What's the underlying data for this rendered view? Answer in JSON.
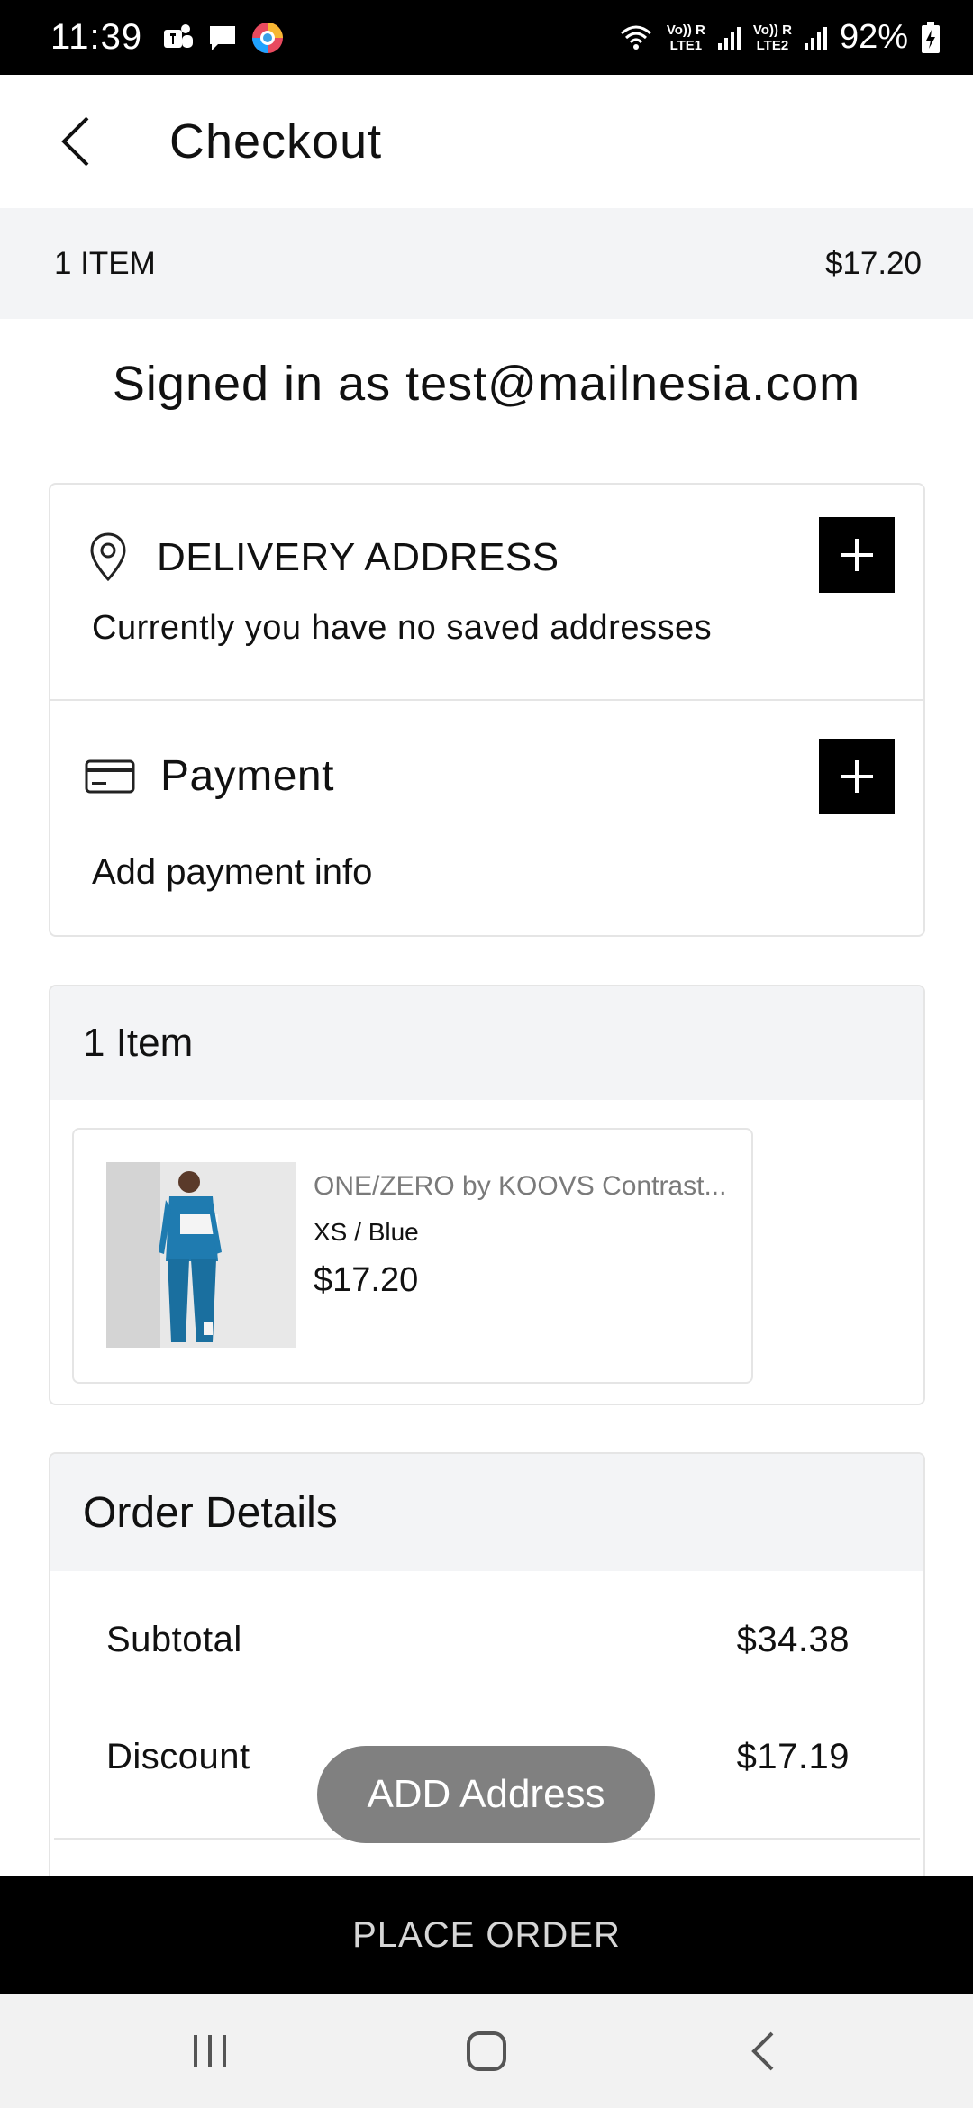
{
  "status_bar": {
    "time": "11:39",
    "sim1_top": "Vo)) R",
    "sim1_bottom": "LTE1",
    "sim2_top": "Vo)) R",
    "sim2_bottom": "LTE2",
    "battery": "92%"
  },
  "header": {
    "title": "Checkout"
  },
  "summary": {
    "item_count": "1 ITEM",
    "total": "$17.20"
  },
  "account": {
    "signed_in_text": "Signed in as test@mailnesia.com"
  },
  "delivery": {
    "title": "DELIVERY ADDRESS",
    "subtitle": "Currently you have no saved addresses"
  },
  "payment": {
    "title": "Payment",
    "subtitle": "Add payment info"
  },
  "items": {
    "heading": "1 Item",
    "product": {
      "name": "ONE/ZERO by KOOVS Contrast...",
      "variant": "XS / Blue",
      "price": "$17.20"
    }
  },
  "order_details": {
    "heading": "Order Details",
    "rows": [
      {
        "label": "Subtotal",
        "value": "$34.38"
      },
      {
        "label": "Discount",
        "value": "$17.19"
      }
    ]
  },
  "toast": {
    "text": "ADD Address"
  },
  "footer": {
    "place_order_label": "PLACE ORDER"
  },
  "colors": {
    "accent": "#000000",
    "panel_bg": "#f3f4f6",
    "product_blue": "#1f7bb0"
  }
}
